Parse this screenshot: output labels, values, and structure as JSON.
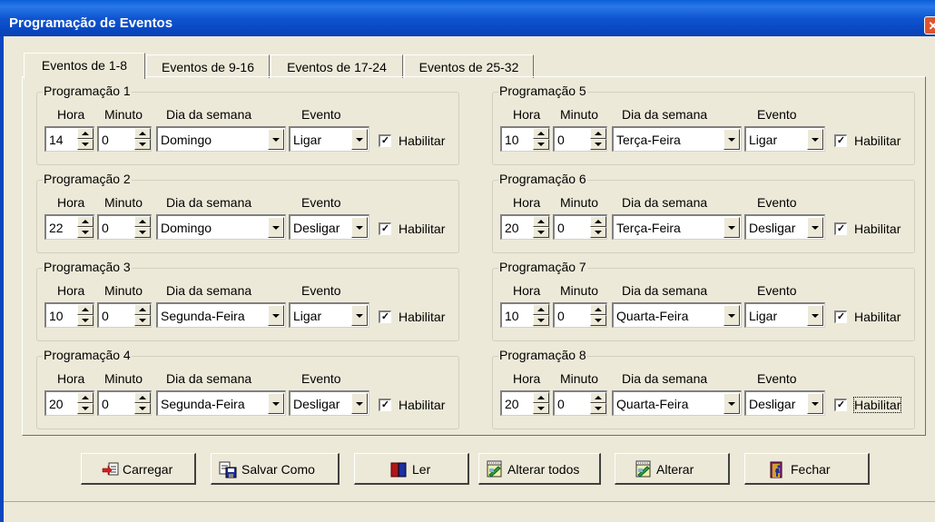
{
  "window": {
    "title": "Programação de Eventos",
    "close_glyph": "✕"
  },
  "tabs": [
    {
      "label": "Eventos de 1-8",
      "active": true
    },
    {
      "label": "Eventos de 9-16"
    },
    {
      "label": "Eventos de 17-24"
    },
    {
      "label": "Eventos de 25-32"
    }
  ],
  "column_labels": {
    "hora": "Hora",
    "minuto": "Minuto",
    "dia": "Dia da semana",
    "evento": "Evento",
    "habilitar": "Habilitar"
  },
  "groups": [
    {
      "title": "Programação 1",
      "hora": "14",
      "minuto": "0",
      "dia": "Domingo",
      "evento": "Ligar",
      "checked": "✓"
    },
    {
      "title": "Programação 2",
      "hora": "22",
      "minuto": "0",
      "dia": "Domingo",
      "evento": "Desligar",
      "checked": "✓"
    },
    {
      "title": "Programação 3",
      "hora": "10",
      "minuto": "0",
      "dia": "Segunda-Feira",
      "evento": "Ligar",
      "checked": "✓"
    },
    {
      "title": "Programação 4",
      "hora": "20",
      "minuto": "0",
      "dia": "Segunda-Feira",
      "evento": "Desligar",
      "checked": "✓"
    },
    {
      "title": "Programação 5",
      "hora": "10",
      "minuto": "0",
      "dia": "Terça-Feira",
      "evento": "Ligar",
      "checked": "✓"
    },
    {
      "title": "Programação 6",
      "hora": "20",
      "minuto": "0",
      "dia": "Terça-Feira",
      "evento": "Desligar",
      "checked": "✓"
    },
    {
      "title": "Programação 7",
      "hora": "10",
      "minuto": "0",
      "dia": "Quarta-Feira",
      "evento": "Ligar",
      "checked": "✓"
    },
    {
      "title": "Programação 8",
      "hora": "20",
      "minuto": "0",
      "dia": "Quarta-Feira",
      "evento": "Desligar",
      "checked": "✓"
    }
  ],
  "buttons": {
    "carregar": {
      "label": "Carregar",
      "icon": "load-icon"
    },
    "salvar": {
      "label": "Salvar Como",
      "icon": "save-as-icon"
    },
    "ler": {
      "label": "Ler",
      "icon": "read-icon"
    },
    "alterar_todos": {
      "label": "Alterar todos",
      "icon": "edit-all-icon"
    },
    "alterar": {
      "label": "Alterar",
      "icon": "edit-icon"
    },
    "fechar": {
      "label": "Fechar",
      "icon": "exit-door-icon"
    }
  },
  "colors": {
    "titlebar": "#0a5fd8",
    "face": "#ece9d8"
  }
}
